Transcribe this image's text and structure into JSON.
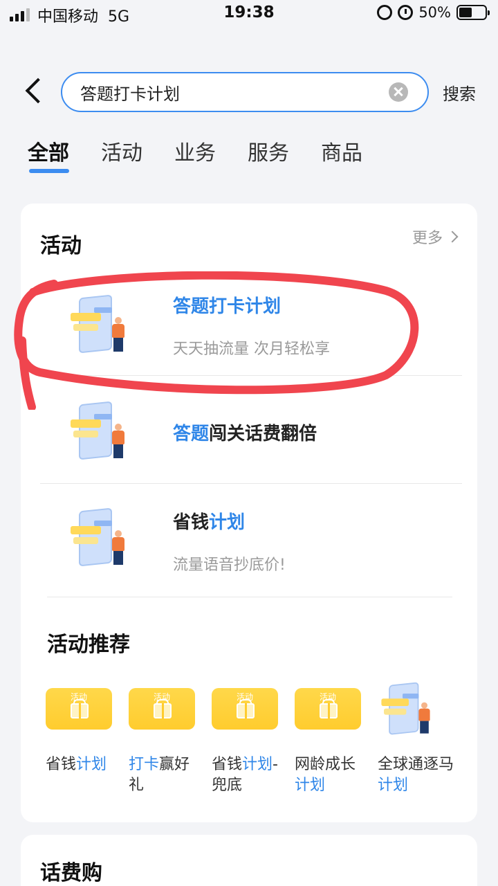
{
  "status_bar": {
    "carrier": "中国移动",
    "network": "5G",
    "time": "19:38",
    "battery": "50%",
    "battery_level": 0.5
  },
  "search": {
    "query": "答题打卡计划",
    "submit_label": "搜索"
  },
  "tabs": [
    {
      "label": "全部",
      "active": true
    },
    {
      "label": "活动",
      "active": false
    },
    {
      "label": "业务",
      "active": false
    },
    {
      "label": "服务",
      "active": false
    },
    {
      "label": "商品",
      "active": false
    }
  ],
  "activity_section": {
    "title": "活动",
    "more_label": "更多",
    "items": [
      {
        "title_hl": "答题打卡计划",
        "title_rest": "",
        "desc": "天天抽流量 次月轻松享"
      },
      {
        "title_hl": "答题",
        "title_rest": "闯关话费翻倍",
        "desc": ""
      },
      {
        "title_plain": "省钱",
        "title_hl": "计划",
        "desc": "流量语音抄底价!"
      }
    ]
  },
  "recommend": {
    "title": "活动推荐",
    "tile_tag": "活动",
    "items": [
      {
        "plain1": "省钱",
        "hl": "计划",
        "plain2": ""
      },
      {
        "plain1": "",
        "hl": "打卡",
        "plain2": "赢好礼"
      },
      {
        "plain1": "省钱",
        "hl": "计划",
        "plain2": "-兜底"
      },
      {
        "plain1": "网龄成长",
        "hl": "计划",
        "plain2": ""
      },
      {
        "plain1": "全球通逐马",
        "hl": "计划",
        "plain2": ""
      }
    ]
  },
  "next_section": {
    "title": "话费购"
  },
  "colors": {
    "accent": "#3c8cf0",
    "highlight_text": "#2f86e8",
    "annotation_red": "#f0454e"
  }
}
